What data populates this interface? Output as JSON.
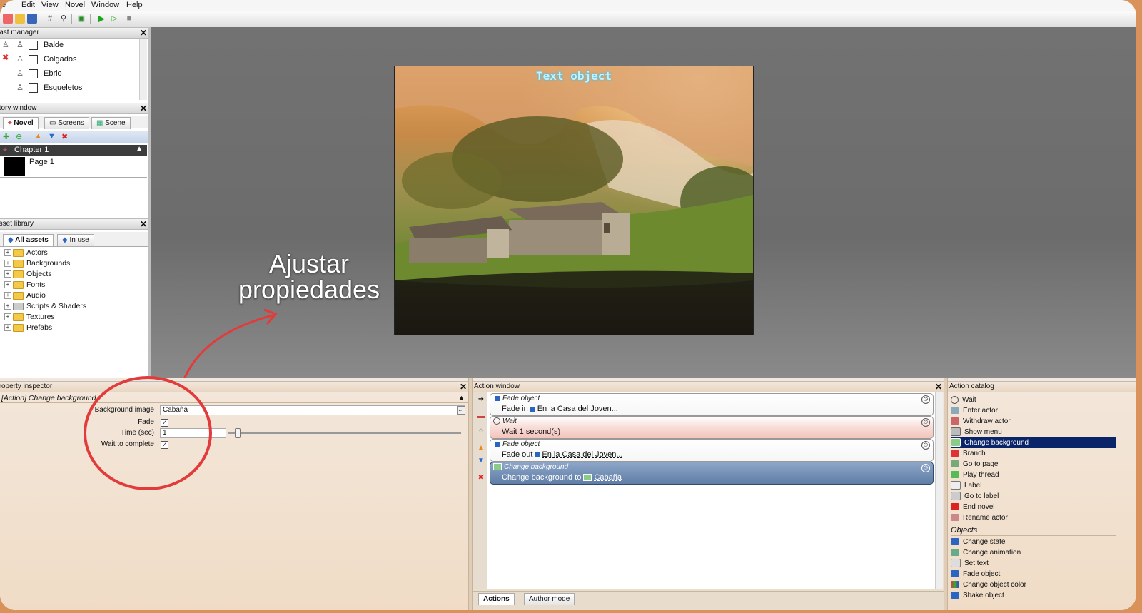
{
  "menu": [
    "e",
    "Edit",
    "View",
    "Novel",
    "Window",
    "Help"
  ],
  "cast_manager": {
    "title": "Cast manager",
    "items": [
      "Balde",
      "Colgados",
      "Ebrio",
      "Esqueletos"
    ]
  },
  "story_window": {
    "title": "Story window",
    "tabs": [
      "Novel",
      "Screens",
      "Scene"
    ],
    "chapter": "Chapter 1",
    "page": "Page 1"
  },
  "asset_library": {
    "title": "Asset library",
    "tabs": [
      "All assets",
      "In use"
    ],
    "tree": [
      "Actors",
      "Backgrounds",
      "Objects",
      "Fonts",
      "Audio",
      "Scripts & Shaders",
      "Textures",
      "Prefabs"
    ]
  },
  "scene": {
    "text_object": "Text object"
  },
  "callout": {
    "line1": "Ajustar",
    "line2": "propiedades"
  },
  "property_inspector": {
    "title": "Property inspector",
    "subtitle": "[Action] Change background",
    "background_label": "Background image",
    "background_value": "Cabaña",
    "fade_label": "Fade",
    "time_label": "Time (sec)",
    "time_value": "1",
    "wait_label": "Wait to complete"
  },
  "action_window": {
    "title": "Action window",
    "actions": [
      {
        "head": "Fade object",
        "verb": "Fade in",
        "target": "En la Casa del Joven..."
      },
      {
        "head": "Wait",
        "verb": "Wait",
        "target": "1 second(s)"
      },
      {
        "head": "Fade object",
        "verb": "Fade out",
        "target": "En la Casa del Joven..."
      },
      {
        "head": "Change background",
        "verb": "Change background to",
        "target": "Cabaña"
      }
    ],
    "bottom_tabs": [
      "Actions",
      "Author mode"
    ]
  },
  "action_catalog": {
    "title": "Action catalog",
    "items": [
      "Wait",
      "Enter actor",
      "Withdraw actor",
      "Show menu",
      "Change background",
      "Branch",
      "Go to page",
      "Play thread",
      "Label",
      "Go to label",
      "End novel",
      "Rename actor"
    ],
    "group": "Objects",
    "object_items": [
      "Change state",
      "Change animation",
      "Set text",
      "Fade object",
      "Change object color",
      "Shake object"
    ]
  }
}
